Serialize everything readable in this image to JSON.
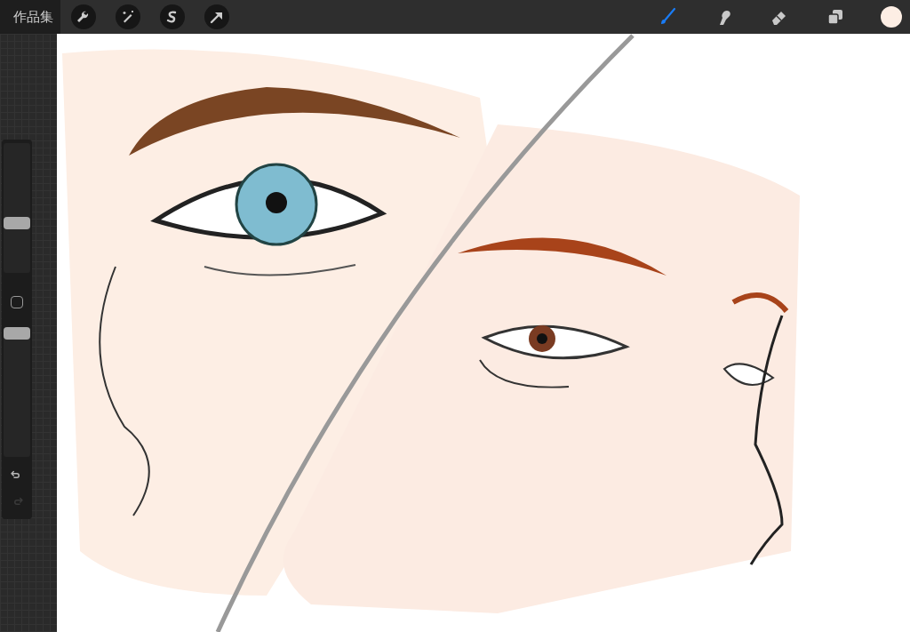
{
  "topbar": {
    "gallery_label": "作品集",
    "actions": [
      {
        "kind": "wrench"
      },
      {
        "kind": "wand"
      },
      {
        "kind": "selection"
      },
      {
        "kind": "transform"
      }
    ],
    "tools": [
      {
        "kind": "brush",
        "selected": true
      },
      {
        "kind": "smudge",
        "selected": false
      },
      {
        "kind": "eraser",
        "selected": false
      },
      {
        "kind": "layers",
        "selected": false
      }
    ],
    "color": "#fdeee4"
  },
  "sidebar": {
    "sliders": [
      {
        "level": 0.37
      },
      {
        "level": 1
      }
    ],
    "undo": {
      "disabled": false
    },
    "redo": {
      "disabled": true
    }
  }
}
